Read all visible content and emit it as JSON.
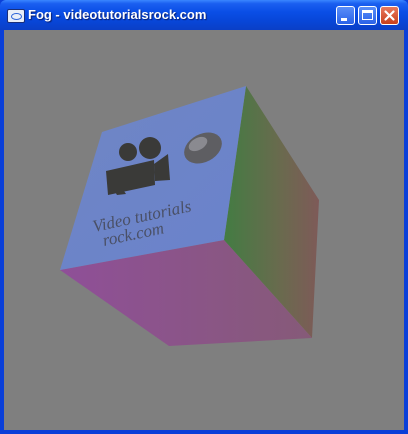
{
  "window": {
    "title": "Fog - videotutorialsrock.com",
    "buttons": {
      "minimize": "minimize-icon",
      "maximize": "maximize-icon",
      "close": "close-icon"
    }
  },
  "scene": {
    "background": "#7f7f7f",
    "cube_label_line1": "Video tutorials",
    "cube_label_line2": "rock.com",
    "front_face_color": "#6a84c9",
    "right_face_colors": [
      "#4f7a4a",
      "#7a5a52"
    ],
    "bottom_face_color": "#8a5a8a",
    "icons": [
      "movie-camera-icon",
      "computer-mouse-icon"
    ]
  }
}
